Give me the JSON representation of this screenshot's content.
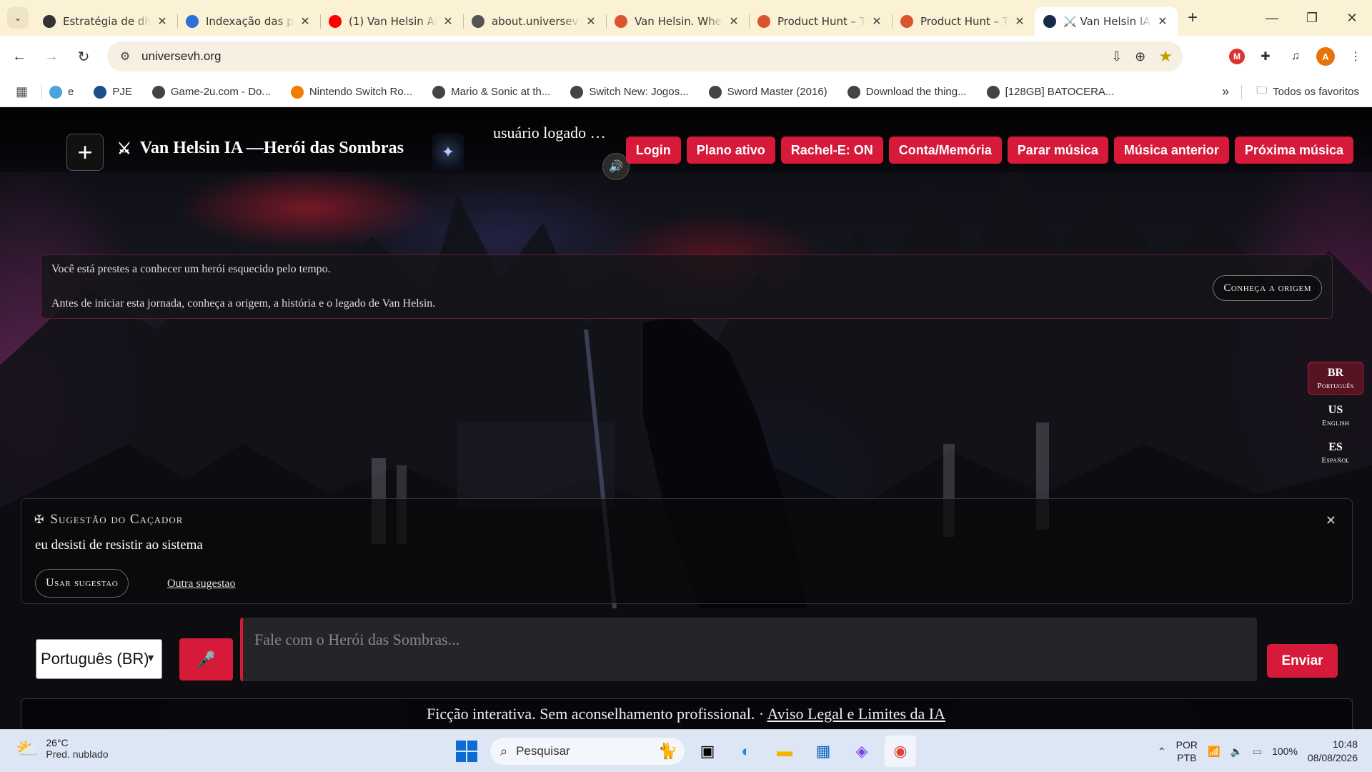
{
  "browser": {
    "tabs": [
      {
        "title": "Estratégia de div",
        "icon_color": "#333333",
        "icon": "globe-icon"
      },
      {
        "title": "Indexação das p",
        "icon_color": "#2f6fd8",
        "icon": "search-console-icon"
      },
      {
        "title": "(1) Van Helsin AI",
        "icon_color": "#ff0000",
        "icon": "youtube-icon"
      },
      {
        "title": "about.universevh",
        "icon_color": "#555555",
        "icon": "globe-icon"
      },
      {
        "title": "Van Helsin. Wher",
        "icon_color": "#da552f",
        "icon": "product-hunt-icon"
      },
      {
        "title": "Product Hunt – T",
        "icon_color": "#da552f",
        "icon": "product-hunt-icon"
      },
      {
        "title": "Product Hunt – T",
        "icon_color": "#da552f",
        "icon": "product-hunt-icon"
      },
      {
        "title": "⚔️ Van Helsin IA",
        "icon_color": "#1a2a4a",
        "icon": "van-helsin-icon",
        "active": true
      }
    ],
    "url": "universevh.org",
    "bookmarks": [
      {
        "label": "e",
        "icon": "ext-icon",
        "color": "#4aa3df"
      },
      {
        "label": "PJE",
        "icon": "pje-icon",
        "color": "#1c4e8a"
      },
      {
        "label": "Game-2u.com - Do...",
        "icon": "globe-icon",
        "color": "#444444"
      },
      {
        "label": "Nintendo Switch Ro...",
        "icon": "blogger-icon",
        "color": "#f57c00"
      },
      {
        "label": "Mario & Sonic at th...",
        "icon": "globe-icon",
        "color": "#444444"
      },
      {
        "label": "Switch New: Jogos...",
        "icon": "globe-icon",
        "color": "#444444"
      },
      {
        "label": "Sword Master (2016)",
        "icon": "globe-icon",
        "color": "#444444"
      },
      {
        "label": "Download the thing...",
        "icon": "globe-icon",
        "color": "#444444"
      },
      {
        "label": "[128GB] BATOCERA...",
        "icon": "globe-icon",
        "color": "#444444"
      }
    ],
    "all_bookmarks": "Todos os favoritos",
    "profile_initial": "A"
  },
  "app": {
    "title": "Van Helsin IA —Herói das Sombras",
    "user_status": "usuário logado …",
    "nav_buttons": [
      "Login",
      "Plano ativo",
      "Rachel-E: ON",
      "Conta/Memória",
      "Parar música",
      "Música anterior",
      "Próxima música"
    ],
    "intro": {
      "line1": "Você está prestes a conhecer um herói esquecido pelo tempo.",
      "line2": "Antes de iniciar esta jornada, conheça a origem, a história e o legado de Van Helsin.",
      "button": "Conheça a origem"
    },
    "languages": [
      {
        "code": "BR",
        "name": "Português",
        "active": true
      },
      {
        "code": "US",
        "name": "English"
      },
      {
        "code": "ES",
        "name": "Español"
      }
    ],
    "suggestion": {
      "title": "Sugestão do Caçador",
      "text": "eu desisti de resistir ao sistema",
      "use_button": "Usar sugestao",
      "other_link": "Outra sugestao"
    },
    "chat": {
      "language_value": "Português (BR)",
      "placeholder": "Fale com o Herói das Sombras...",
      "send": "Enviar"
    },
    "footer": {
      "text": "Ficção interativa. Sem aconselhamento profissional. ·",
      "link": "Aviso Legal e Limites da IA"
    },
    "accent_color": "#d7193a"
  },
  "taskbar": {
    "temperature": "26°C",
    "weather": "Pred. nublado",
    "search": "Pesquisar",
    "lang_top": "POR",
    "lang_bottom": "PTB",
    "battery": "100%",
    "time": "10:48",
    "date": "08/08/2026"
  }
}
